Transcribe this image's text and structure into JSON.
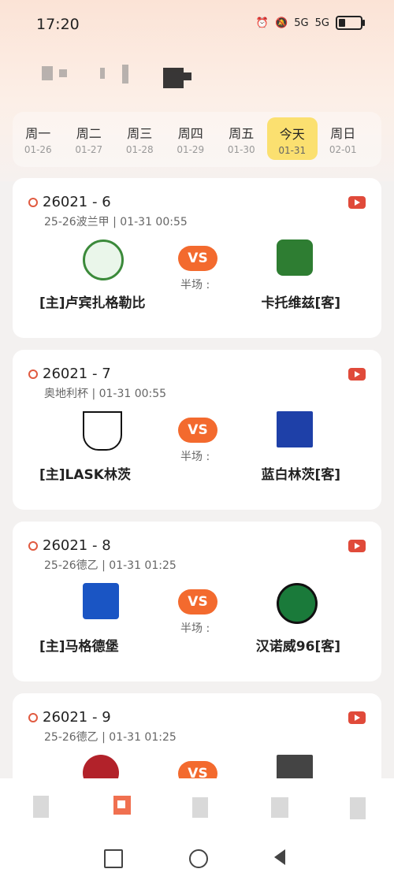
{
  "status_bar": {
    "time": "17:20",
    "signal1": "5G",
    "signal2": "5G"
  },
  "week": [
    {
      "name": "周一",
      "date": "01-26",
      "active": false
    },
    {
      "name": "周二",
      "date": "01-27",
      "active": false
    },
    {
      "name": "周三",
      "date": "01-28",
      "active": false
    },
    {
      "name": "周四",
      "date": "01-29",
      "active": false
    },
    {
      "name": "周五",
      "date": "01-30",
      "active": false
    },
    {
      "name": "今天",
      "date": "01-31",
      "active": true
    },
    {
      "name": "周日",
      "date": "02-01",
      "active": false
    }
  ],
  "matches": [
    {
      "code": "26021 - 6",
      "meta": "25-26波兰甲 | 01-31 00:55",
      "vs": "VS",
      "half": "半场 :",
      "home": "[主]卢宾扎格勒比",
      "away": "卡托维兹[客]",
      "home_color": "#3b8a3a",
      "away_color": "#2e7d32"
    },
    {
      "code": "26021 - 7",
      "meta": "奥地利杯 | 01-31 00:55",
      "vs": "VS",
      "half": "半场 :",
      "home": "[主]LASK林茨",
      "away": "蓝白林茨[客]",
      "home_color": "#111111",
      "away_color": "#1e40a8"
    },
    {
      "code": "26021 - 8",
      "meta": "25-26德乙 | 01-31 01:25",
      "vs": "VS",
      "half": "半场 :",
      "home": "[主]马格德堡",
      "away": "汉诺威96[客]",
      "home_color": "#1a55c4",
      "away_color": "#1a7a3a"
    },
    {
      "code": "26021 - 9",
      "meta": "25-26德乙 | 01-31 01:25",
      "vs": "VS",
      "half": "",
      "home": "",
      "away": "",
      "home_color": "#b2222a",
      "away_color": "#222222"
    }
  ]
}
